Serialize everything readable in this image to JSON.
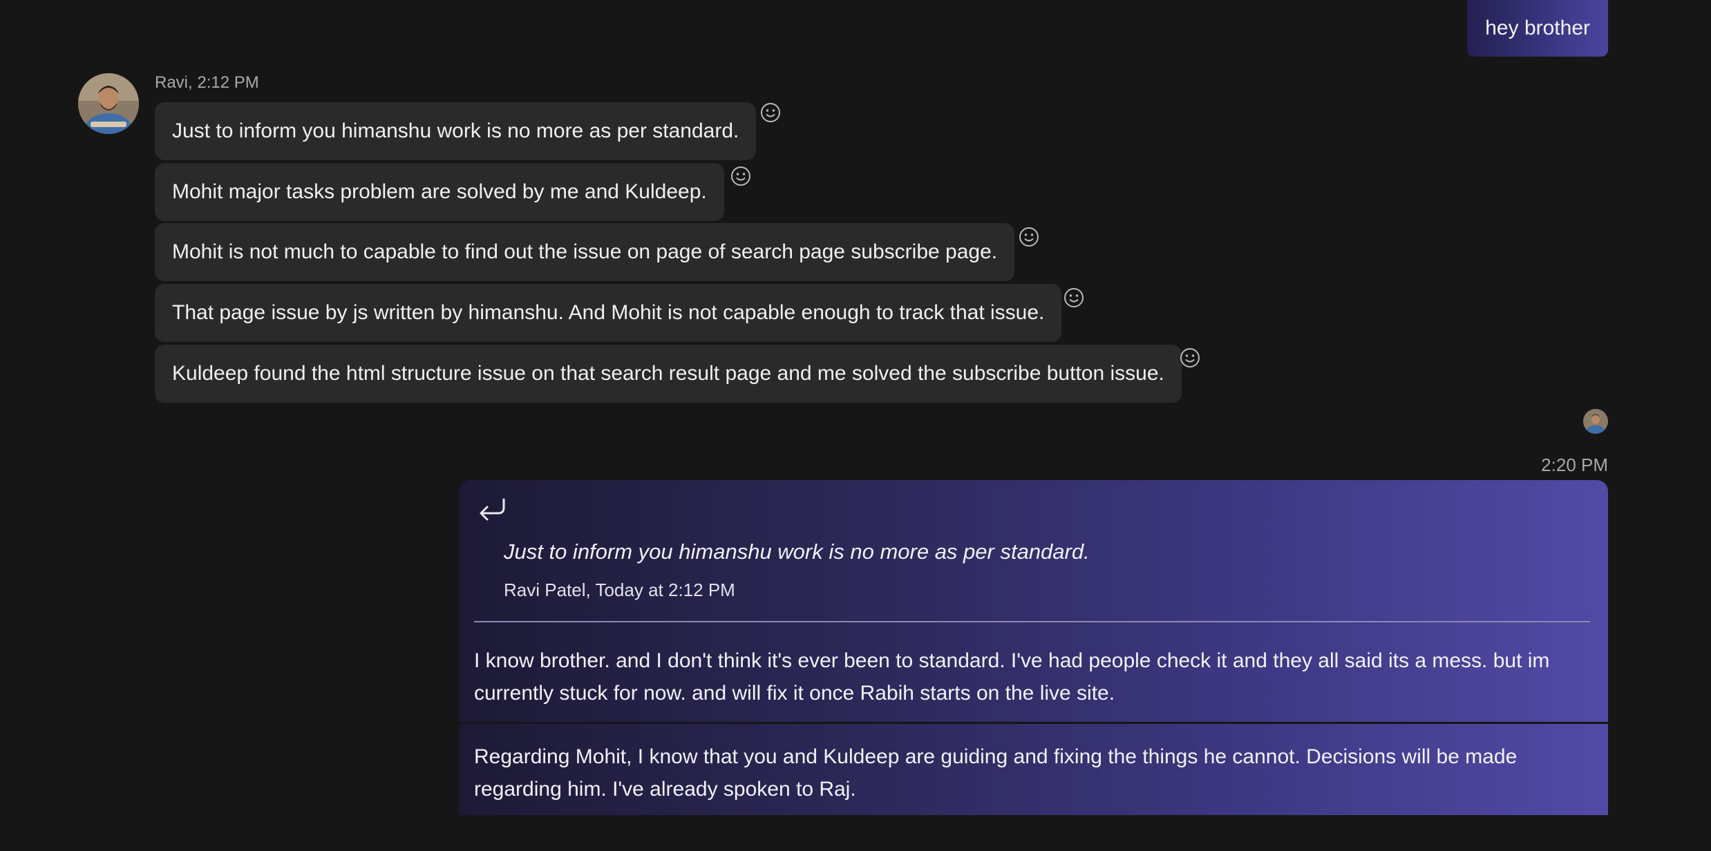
{
  "conversation": {
    "outgoing_first": {
      "text": "hey brother"
    },
    "incoming": {
      "sender": "Ravi, 2:12 PM",
      "messages": [
        "Just to inform you himanshu work is no more as per standard.",
        "Mohit major tasks problem are solved by me and Kuldeep.",
        "Mohit is not much to capable to find out the issue on page of search page subscribe page.",
        "That page issue by js written by himanshu. And Mohit is not capable enough to track that issue.",
        "Kuldeep found the html structure issue on that search result page and me solved the subscribe button issue."
      ],
      "reaction_icon": "smiley-icon"
    },
    "reply": {
      "time": "2:20 PM",
      "reply_icon": "reply-arrow-icon",
      "quoted_text": "Just to inform you himanshu work is no more as per standard.",
      "quoted_meta": "Ravi Patel, Today at 2:12 PM",
      "text": "I know brother. and I don't think it's ever been to standard. I've had people check it and they all said its a mess. but im currently stuck for now. and will fix it once Rabih starts on the live site.",
      "followup": "Regarding Mohit, I know that you and Kuldeep are guiding and fixing the things he cannot. Decisions will be made regarding him. I've already spoken to Raj."
    },
    "colors": {
      "background": "#161616",
      "incoming_bubble": "#2a2a2a",
      "outgoing_gradient_start": "#1d1a36",
      "outgoing_gradient_end": "#524aa6"
    }
  }
}
